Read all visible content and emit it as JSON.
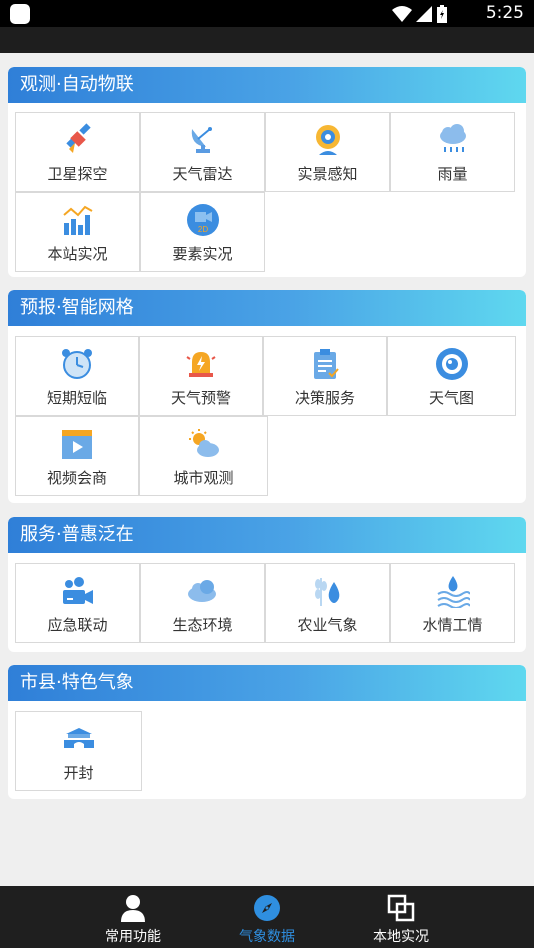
{
  "status_bar": {
    "time": "5:25"
  },
  "sections": [
    {
      "title": "观测·自动物联",
      "items": [
        {
          "label": "卫星探空",
          "icon": "satellite-icon"
        },
        {
          "label": "天气雷达",
          "icon": "radar-dish-icon"
        },
        {
          "label": "实景感知",
          "icon": "webcam-icon"
        },
        {
          "label": "雨量",
          "icon": "rain-cloud-icon"
        },
        {
          "label": "本站实况",
          "icon": "bar-chart-icon"
        },
        {
          "label": "要素实况",
          "icon": "2d-element-icon"
        }
      ]
    },
    {
      "title": "预报·智能网格",
      "items": [
        {
          "label": "短期短临",
          "icon": "alarm-clock-icon"
        },
        {
          "label": "天气预警",
          "icon": "alert-bell-icon"
        },
        {
          "label": "决策服务",
          "icon": "clipboard-icon"
        },
        {
          "label": "天气图",
          "icon": "eye-icon"
        },
        {
          "label": "视频会商",
          "icon": "video-icon"
        },
        {
          "label": "城市观测",
          "icon": "sun-cloud-icon"
        }
      ]
    },
    {
      "title": "服务·普惠泛在",
      "items": [
        {
          "label": "应急联动",
          "icon": "video-camera-group-icon"
        },
        {
          "label": "生态环境",
          "icon": "cloud-ecology-icon"
        },
        {
          "label": "农业气象",
          "icon": "wheat-drop-icon"
        },
        {
          "label": "水情工情",
          "icon": "water-waves-icon"
        }
      ]
    },
    {
      "title": "市县·特色气象",
      "items": [
        {
          "label": "开封",
          "icon": "city-gate-icon"
        }
      ]
    }
  ],
  "bottom_nav": [
    {
      "label": "常用功能",
      "icon": "person-icon",
      "active": false
    },
    {
      "label": "气象数据",
      "icon": "compass-icon",
      "active": true
    },
    {
      "label": "本地实况",
      "icon": "layers-icon",
      "active": false
    }
  ],
  "colors": {
    "header_gradient_start": "#2f7fd8",
    "header_gradient_end": "#5fd8ef",
    "active_nav": "#2f8fe0",
    "icon_blue": "#3b8de0",
    "icon_orange": "#f5a623"
  }
}
